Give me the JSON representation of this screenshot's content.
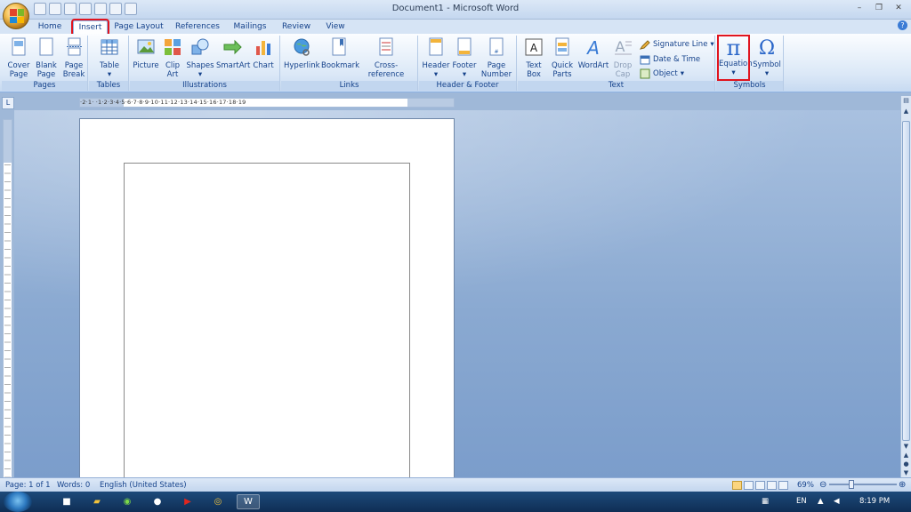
{
  "window": {
    "title": "Document1 - Microsoft Word",
    "minimize": "–",
    "maximize": "❐",
    "close": "✕"
  },
  "tabs": [
    {
      "label": "Home"
    },
    {
      "label": "Insert"
    },
    {
      "label": "Page Layout"
    },
    {
      "label": "References"
    },
    {
      "label": "Mailings"
    },
    {
      "label": "Review"
    },
    {
      "label": "View"
    }
  ],
  "ribbon": {
    "groups": {
      "pages": "Pages",
      "tables": "Tables",
      "illustrations": "Illustrations",
      "links": "Links",
      "header_footer": "Header & Footer",
      "text": "Text",
      "symbols": "Symbols"
    },
    "buttons": {
      "cover_page_1": "Cover",
      "cover_page_2": "Page",
      "blank_page_1": "Blank",
      "blank_page_2": "Page",
      "page_break_1": "Page",
      "page_break_2": "Break",
      "table": "Table",
      "picture": "Picture",
      "clip_art_1": "Clip",
      "clip_art_2": "Art",
      "shapes": "Shapes",
      "smartart": "SmartArt",
      "chart": "Chart",
      "hyperlink": "Hyperlink",
      "bookmark": "Bookmark",
      "cross_reference": "Cross-reference",
      "header": "Header",
      "footer": "Footer",
      "page_number_1": "Page",
      "page_number_2": "Number",
      "text_box_1": "Text",
      "text_box_2": "Box",
      "quick_parts_1": "Quick",
      "quick_parts_2": "Parts",
      "wordart": "WordArt",
      "drop_cap_1": "Drop",
      "drop_cap_2": "Cap",
      "signature_line": "Signature Line",
      "date_time": "Date & Time",
      "object": "Object",
      "equation": "Equation",
      "symbol": "Symbol",
      "pi_glyph": "π",
      "omega_glyph": "Ω",
      "a_glyph": "A"
    }
  },
  "ruler": {
    "corner": "L",
    "horizontal_numbers": "·2·1·  ·1·2·3·4·5·6·7·8·9·10·11·12·13·14·15·16·17·18·19"
  },
  "status": {
    "page": "Page: 1 of 1",
    "words": "Words: 0",
    "language": "English (United States)",
    "zoom": "69%"
  },
  "taskbar": {
    "language": "EN",
    "time": "8:19 PM"
  },
  "colors": {
    "highlight": "#e0141e",
    "ribbon_text": "#15428b"
  }
}
